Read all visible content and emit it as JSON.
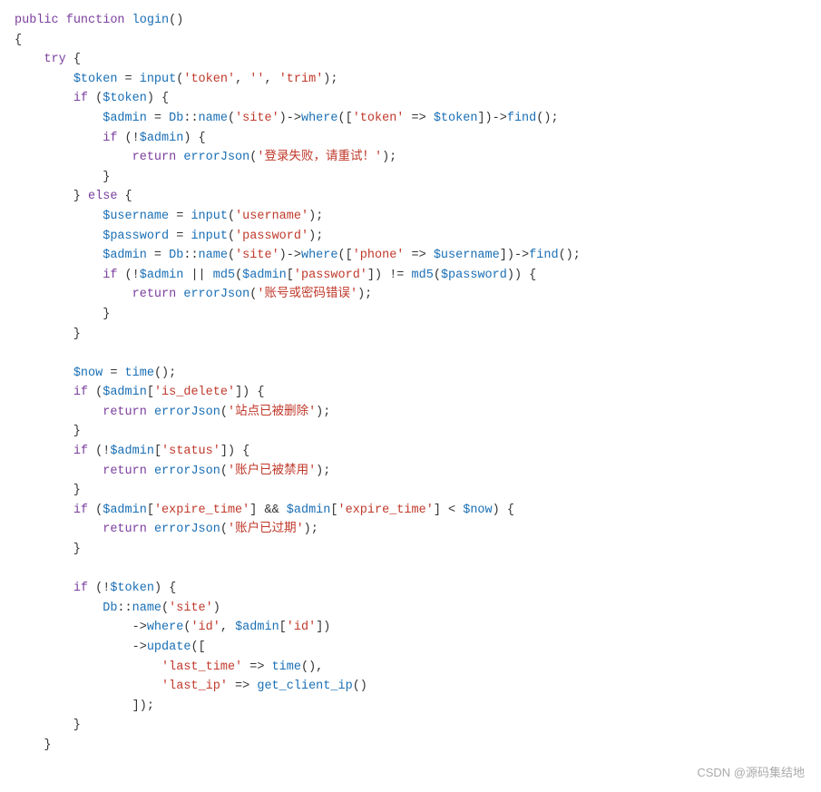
{
  "code": {
    "lines": [
      {
        "id": 1,
        "text": "public function login()"
      },
      {
        "id": 2,
        "text": "{"
      },
      {
        "id": 3,
        "text": "    try {"
      },
      {
        "id": 4,
        "text": "        $token = input('token', '', 'trim');"
      },
      {
        "id": 5,
        "text": "        if ($token) {"
      },
      {
        "id": 6,
        "text": "            $admin = Db::name('site')->where(['token' => $token])->find();"
      },
      {
        "id": 7,
        "text": "            if (!$admin) {"
      },
      {
        "id": 8,
        "text": "                return errorJson('登录失败，请重试！');"
      },
      {
        "id": 9,
        "text": "            }"
      },
      {
        "id": 10,
        "text": "        } else {"
      },
      {
        "id": 11,
        "text": "            $username = input('username');"
      },
      {
        "id": 12,
        "text": "            $password = input('password');"
      },
      {
        "id": 13,
        "text": "            $admin = Db::name('site')->where(['phone' => $username])->find();"
      },
      {
        "id": 14,
        "text": "            if (!$admin || md5($admin['password']) != md5($password)) {"
      },
      {
        "id": 15,
        "text": "                return errorJson('账号或密码错误');"
      },
      {
        "id": 16,
        "text": "            }"
      },
      {
        "id": 17,
        "text": "        }"
      },
      {
        "id": 18,
        "text": ""
      },
      {
        "id": 19,
        "text": "        $now = time();"
      },
      {
        "id": 20,
        "text": "        if ($admin['is_delete']) {"
      },
      {
        "id": 21,
        "text": "            return errorJson('站点已被删除');"
      },
      {
        "id": 22,
        "text": "        }"
      },
      {
        "id": 23,
        "text": "        if (!$admin['status']) {"
      },
      {
        "id": 24,
        "text": "            return errorJson('账户已被禁用');"
      },
      {
        "id": 25,
        "text": "        }"
      },
      {
        "id": 26,
        "text": "        if ($admin['expire_time'] && $admin['expire_time'] < $now) {"
      },
      {
        "id": 27,
        "text": "            return errorJson('账户已过期');"
      },
      {
        "id": 28,
        "text": "        }"
      },
      {
        "id": 29,
        "text": ""
      },
      {
        "id": 30,
        "text": "        if (!$token) {"
      },
      {
        "id": 31,
        "text": "            Db::name('site')"
      },
      {
        "id": 32,
        "text": "                ->where('id', $admin['id'])"
      },
      {
        "id": 33,
        "text": "                ->update(["
      },
      {
        "id": 34,
        "text": "                    'last_time' => time(),"
      },
      {
        "id": 35,
        "text": "                    'last_ip' => get_client_ip()"
      },
      {
        "id": 36,
        "text": "                ]);"
      },
      {
        "id": 37,
        "text": "        }"
      },
      {
        "id": 38,
        "text": "    }"
      }
    ]
  },
  "watermark": "CSDN @源码集结地"
}
